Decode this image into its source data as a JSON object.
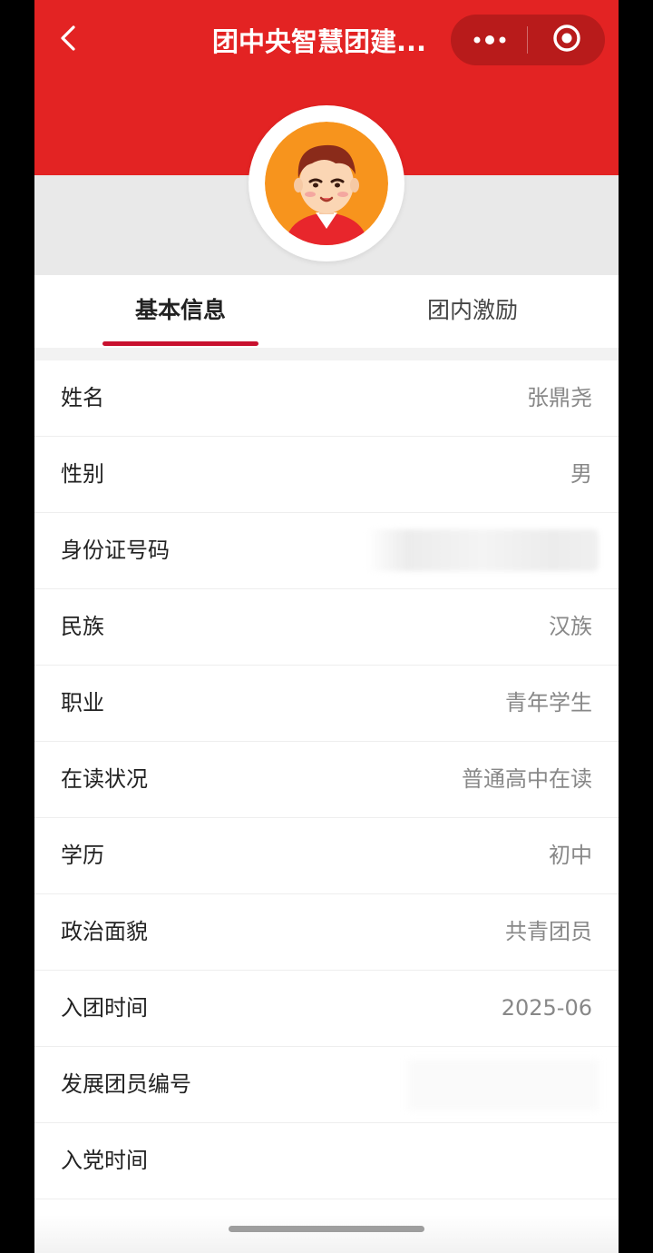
{
  "header": {
    "title": "团中央智慧团建...",
    "colors": {
      "primary": "#e32323",
      "capsule": "#b81b1b",
      "tab_accent": "#c8102e"
    },
    "icons": {
      "back": "chevron-left-icon",
      "more": "more-dots-icon",
      "close": "target-circle-icon"
    }
  },
  "tabs": [
    {
      "label": "基本信息",
      "active": true
    },
    {
      "label": "团内激励",
      "active": false
    }
  ],
  "rows": [
    {
      "label": "姓名",
      "value": "张鼎尧"
    },
    {
      "label": "性别",
      "value": "男"
    },
    {
      "label": "身份证号码",
      "value": ""
    },
    {
      "label": "民族",
      "value": "汉族"
    },
    {
      "label": "职业",
      "value": "青年学生"
    },
    {
      "label": "在读状况",
      "value": "普通高中在读"
    },
    {
      "label": "学历",
      "value": "初中"
    },
    {
      "label": "政治面貌",
      "value": "共青团员"
    },
    {
      "label": "入团时间",
      "value": "2025-06"
    },
    {
      "label": "发展团员编号",
      "value": ""
    },
    {
      "label": "入党时间",
      "value": ""
    }
  ]
}
